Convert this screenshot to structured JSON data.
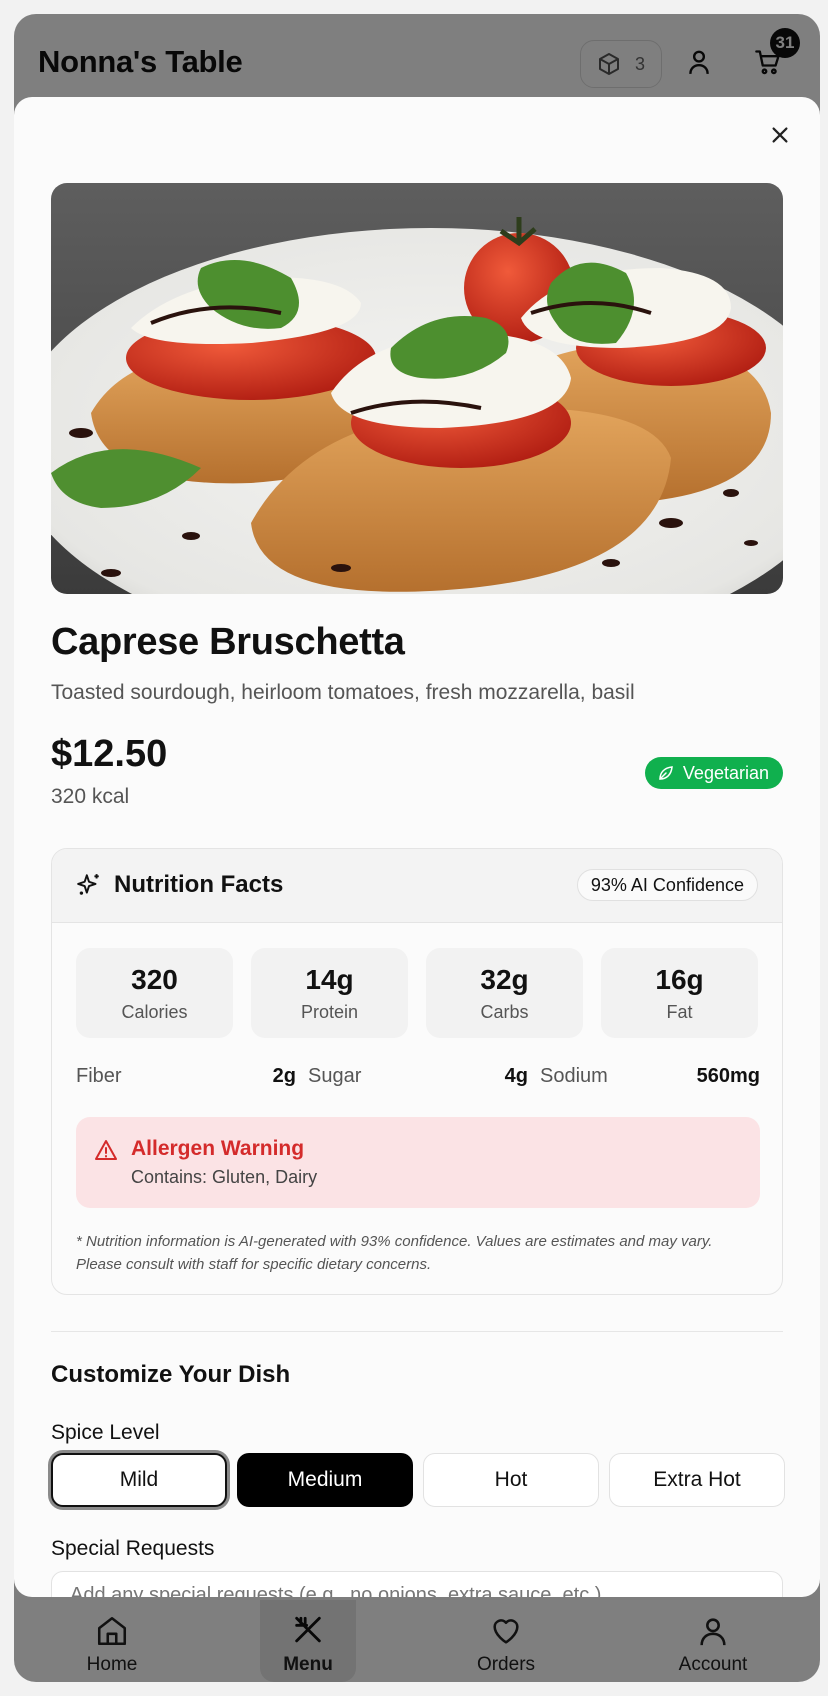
{
  "app": {
    "title": "Nonna's Table",
    "box_count": "3",
    "cart_count": "31"
  },
  "nav": [
    {
      "label": "Home",
      "icon": "home-icon"
    },
    {
      "label": "Menu",
      "icon": "utensils-icon"
    },
    {
      "label": "Orders",
      "icon": "heart-icon"
    },
    {
      "label": "Account",
      "icon": "user-icon"
    }
  ],
  "dish": {
    "name": "Caprese Bruschetta",
    "description": "Toasted sourdough, heirloom tomatoes, fresh mozzarella, basil",
    "price": "$12.50",
    "kcal": "320 kcal",
    "badge": "Vegetarian"
  },
  "nutrition": {
    "title": "Nutrition Facts",
    "confidence": "93% AI Confidence",
    "macros": [
      {
        "value": "320",
        "label": "Calories"
      },
      {
        "value": "14g",
        "label": "Protein"
      },
      {
        "value": "32g",
        "label": "Carbs"
      },
      {
        "value": "16g",
        "label": "Fat"
      }
    ],
    "minor": [
      {
        "label": "Fiber",
        "value": "2g"
      },
      {
        "label": "Sugar",
        "value": "4g"
      },
      {
        "label": "Sodium",
        "value": "560mg"
      }
    ],
    "allergen_title": "Allergen Warning",
    "allergen_text": "Contains: Gluten, Dairy",
    "disclaimer": "* Nutrition information is AI-generated with 93% confidence. Values are estimates and may vary. Please consult with staff for specific dietary concerns."
  },
  "customize": {
    "title": "Customize Your Dish",
    "spice_label": "Spice Level",
    "spice_options": [
      "Mild",
      "Medium",
      "Hot",
      "Extra Hot"
    ],
    "spice_selected": "Medium",
    "requests_label": "Special Requests",
    "requests_placeholder": "Add any special requests (e.g., no onions, extra sauce, etc.)"
  },
  "colors": {
    "accent_green": "#10b04e",
    "allergen_red": "#d42b2b",
    "allergen_bg": "#fbe3e5"
  }
}
